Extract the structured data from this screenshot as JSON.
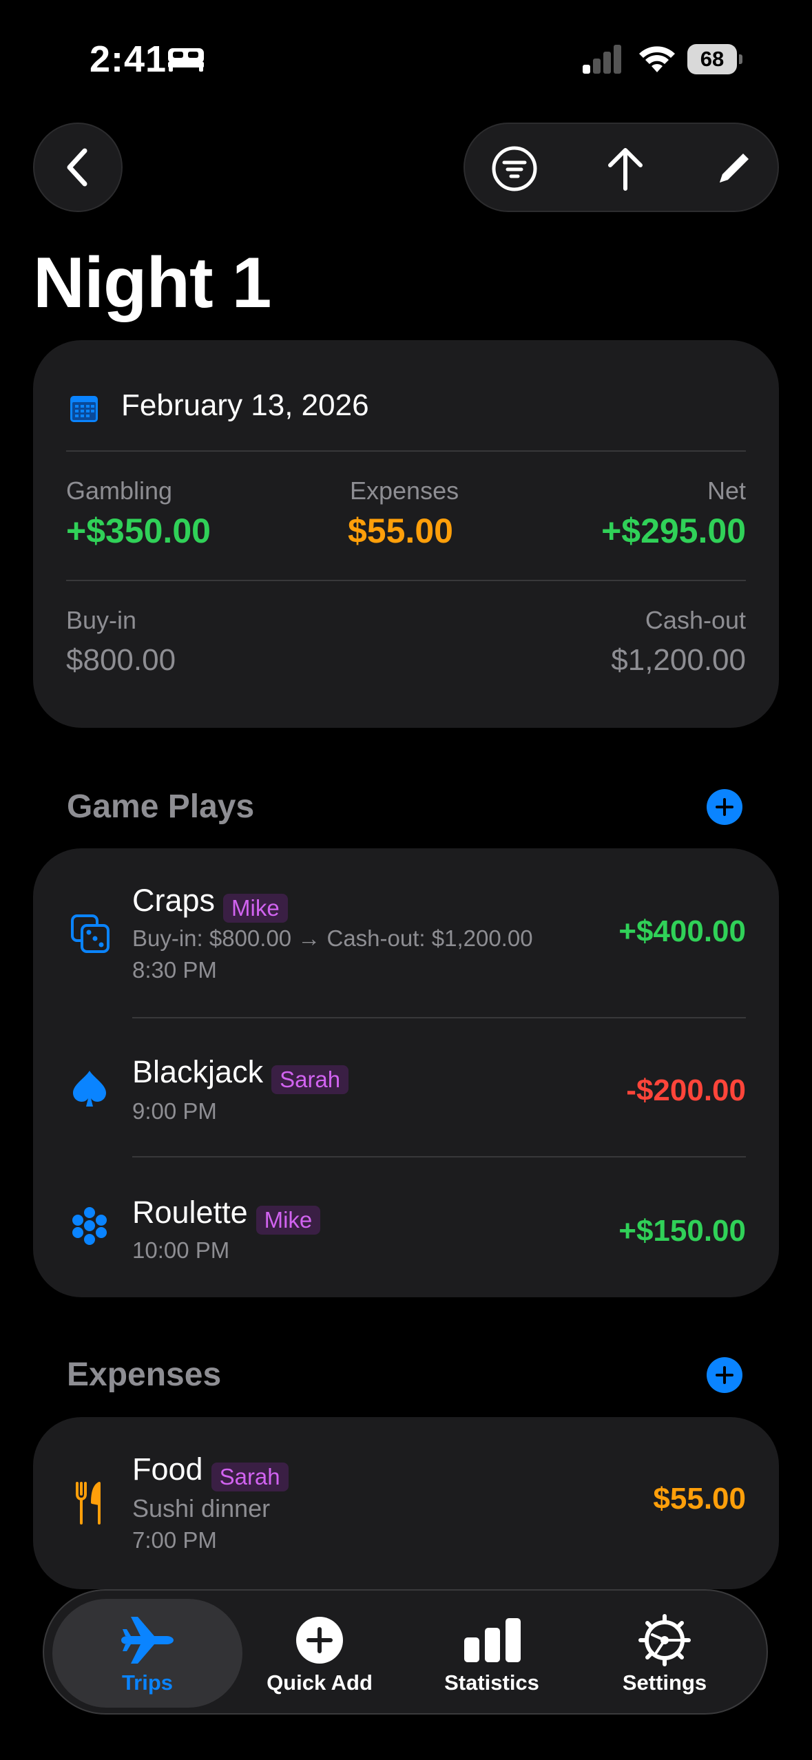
{
  "status_bar": {
    "time": "2:41",
    "battery": "68"
  },
  "page": {
    "title": "Night 1"
  },
  "summary": {
    "date": "February 13, 2026",
    "gambling_label": "Gambling",
    "gambling_value": "+$350.00",
    "expenses_label": "Expenses",
    "expenses_value": "$55.00",
    "net_label": "Net",
    "net_value": "+$295.00",
    "buyin_label": "Buy-in",
    "buyin_value": "$800.00",
    "cashout_label": "Cash-out",
    "cashout_value": "$1,200.00"
  },
  "game_plays": {
    "title": "Game Plays",
    "items": [
      {
        "icon": "dice-icon",
        "name": "Craps",
        "player": "Mike",
        "detail": "Buy-in: $800.00 → Cash-out: $1,200.00",
        "time": "8:30 PM",
        "amount": "+$400.00"
      },
      {
        "icon": "spade-icon",
        "name": "Blackjack",
        "player": "Sarah",
        "time": "9:00 PM",
        "amount": "-$200.00"
      },
      {
        "icon": "roulette-icon",
        "name": "Roulette",
        "player": "Mike",
        "time": "10:00 PM",
        "amount": "+$150.00"
      }
    ]
  },
  "expenses": {
    "title": "Expenses",
    "items": [
      {
        "icon": "fork-knife-icon",
        "name": "Food",
        "player": "Sarah",
        "note": "Sushi dinner",
        "time": "7:00 PM",
        "amount": "$55.00"
      }
    ]
  },
  "tab_bar": {
    "tabs": [
      {
        "label": "Trips",
        "icon": "airplane-icon",
        "active": true
      },
      {
        "label": "Quick Add",
        "icon": "plus-circle-icon"
      },
      {
        "label": "Statistics",
        "icon": "bar-chart-icon"
      },
      {
        "label": "Settings",
        "icon": "gear-icon"
      }
    ]
  },
  "colors": {
    "accent": "#0a84ff",
    "positive": "#30d158",
    "negative": "#ff453a",
    "expense": "#ff9f0a",
    "tag": "#d163f0"
  }
}
